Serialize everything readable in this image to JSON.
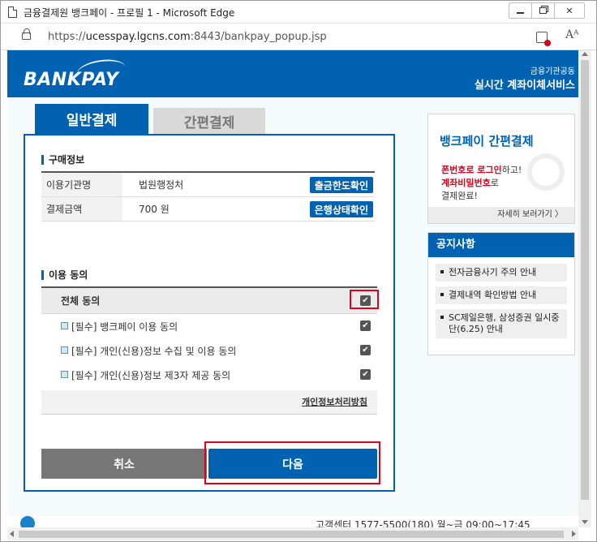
{
  "browser": {
    "title": "금융결제원 뱅크페이 - 프로필 1 - Microsoft Edge",
    "url_scheme": "https://",
    "url_host": "ucesspay.lgcns.com",
    "url_rest": ":8443/bankpay_popup.jsp",
    "read_aloud": "Aᴬ"
  },
  "header": {
    "logo": "BANKPAY",
    "subtitle": "금융기관공동",
    "title": "실시간 계좌이체서비스"
  },
  "tabs": [
    {
      "label": "일반결제",
      "active": true
    },
    {
      "label": "간편결제",
      "active": false
    }
  ],
  "purchase": {
    "section_title": "구매정보",
    "rows": [
      {
        "label": "이용기관명",
        "value": "법원행정처",
        "button": "출금한도확인"
      },
      {
        "label": "결제금액",
        "value": "700 원",
        "button": "은행상태확인"
      }
    ]
  },
  "agreement": {
    "section_title": "이용 동의",
    "all_label": "전체 동의",
    "items": [
      {
        "label": "[필수] 뱅크페이 이용 동의",
        "checked": true
      },
      {
        "label": "[필수] 개인(신용)정보 수집 및 이용 동의",
        "checked": true
      },
      {
        "label": "[필수] 개인(신용)정보 제3자 제공 동의",
        "checked": true
      }
    ],
    "privacy_link": "개인정보처리방침",
    "check_mark": "✔"
  },
  "actions": {
    "cancel": "취소",
    "next": "다음"
  },
  "promo": {
    "title": "뱅크페이 간편결제",
    "line1_red": "폰번호로 로그인",
    "line1_rest": "하고!",
    "line2_red": "계좌비밀번호",
    "line2_rest": "로",
    "line3": "결제완료!",
    "more": "자세히 보러가기 〉"
  },
  "notice": {
    "title": "공지사항",
    "items": [
      "전자금융사기 주의 안내",
      "결제내역 확인방법 안내",
      "SC제일은행, 삼성증권 일시중단(6.25) 안내"
    ]
  },
  "footer": {
    "text": "고객센터 1577-5500(180)   월~금 09:00~17:45"
  },
  "colors": {
    "brand_blue": "#0062b1",
    "highlight_red": "#e0001b"
  }
}
